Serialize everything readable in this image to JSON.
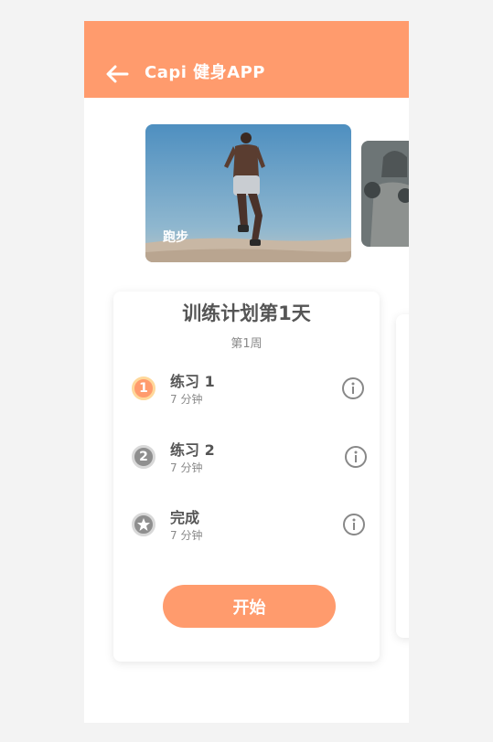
{
  "header": {
    "title": "Capi 健身APP",
    "back_icon": "arrow-left-icon"
  },
  "carousel": {
    "cards": [
      {
        "label": "跑步"
      }
    ]
  },
  "plan": {
    "title": "训练计划第1天",
    "subtitle": "第1周",
    "items": [
      {
        "badge": "1",
        "title": "练习 1",
        "duration": "7 分钟",
        "state": "active"
      },
      {
        "badge": "2",
        "title": "练习 2",
        "duration": "7 分钟",
        "state": "idle"
      },
      {
        "badge": "star",
        "title": "完成",
        "duration": "7 分钟",
        "state": "idle"
      }
    ],
    "start_label": "开始"
  },
  "colors": {
    "accent": "#ff9b6d",
    "accent_ring": "#ffd89a",
    "idle_badge": "#8f8f8f"
  }
}
